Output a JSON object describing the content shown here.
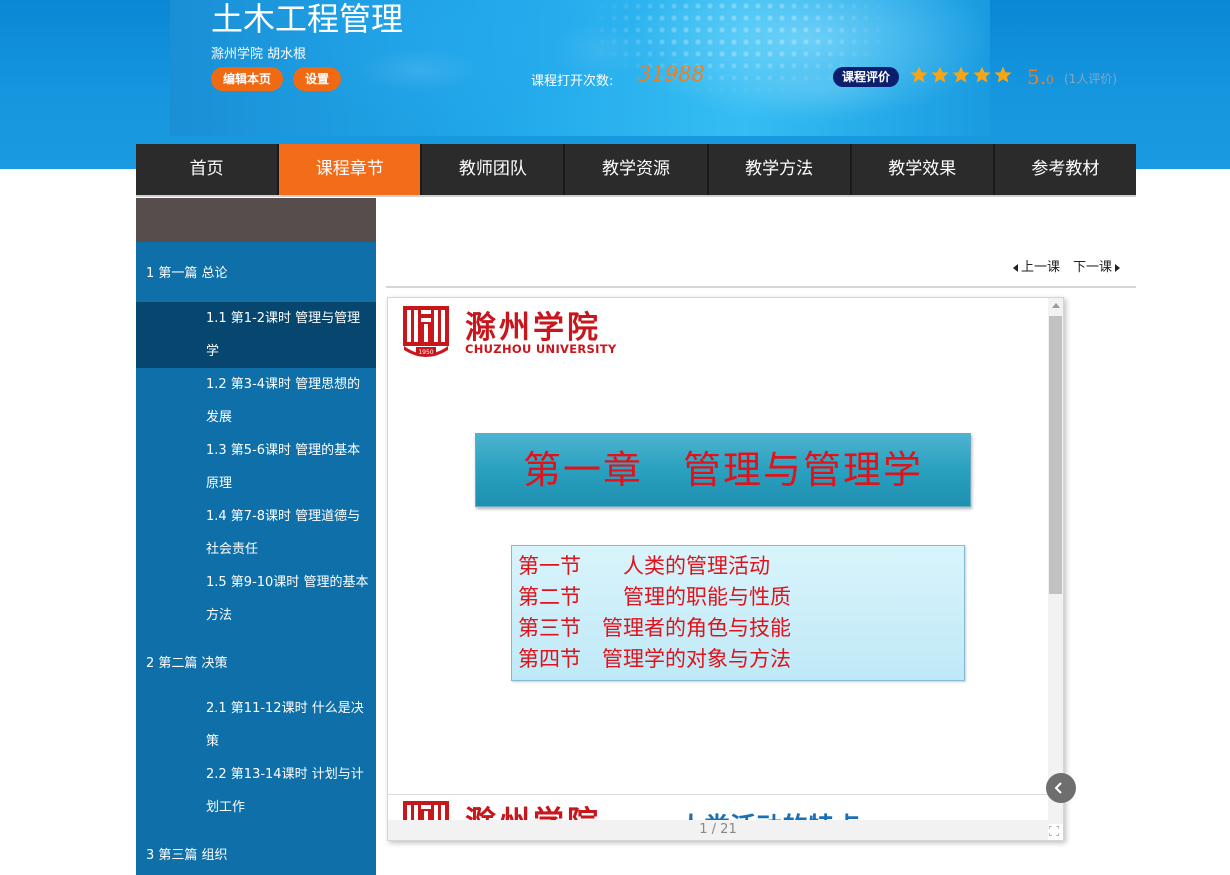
{
  "header": {
    "course_title": "土木工程管理",
    "school_teacher": "滁州学院 胡水根",
    "edit_button": "编辑本页",
    "settings_button": "设置",
    "open_count_label": "课程打开次数:",
    "open_count_value": "31988",
    "evaluation_badge": "课程评价",
    "rating_stars": 5,
    "rating_score_main": "5.",
    "rating_score_sub": "0",
    "rating_count": "(1人评价)",
    "star_color": "#f7a515"
  },
  "nav": {
    "tabs": [
      {
        "label": "首页",
        "active": false
      },
      {
        "label": "课程章节",
        "active": true
      },
      {
        "label": "教师团队",
        "active": false
      },
      {
        "label": "教学资源",
        "active": false
      },
      {
        "label": "教学方法",
        "active": false
      },
      {
        "label": "教学效果",
        "active": false
      },
      {
        "label": "参考教材",
        "active": false
      }
    ],
    "active_color": "#f26c1a"
  },
  "sidebar": {
    "sections": [
      {
        "label": "1 第一篇 总论",
        "lessons": [
          {
            "line1": "1.1 第1-2课时 管理与管理",
            "line2": "学",
            "active": true
          },
          {
            "line1": "1.2 第3-4课时 管理思想的",
            "line2": "发展",
            "active": false
          },
          {
            "line1": "1.3 第5-6课时 管理的基本",
            "line2": "原理",
            "active": false
          },
          {
            "line1": "1.4 第7-8课时 管理道德与",
            "line2": "社会责任",
            "active": false
          },
          {
            "line1": "1.5 第9-10课时 管理的基本",
            "line2": "方法",
            "active": false
          }
        ]
      },
      {
        "label": "2 第二篇 决策",
        "lessons": [
          {
            "line1": "2.1 第11-12课时 什么是决",
            "line2": "策",
            "active": false
          },
          {
            "line1": "2.2 第13-14课时 计划与计",
            "line2": "划工作",
            "active": false
          }
        ]
      },
      {
        "label": "3 第三篇 组织",
        "lessons": []
      }
    ]
  },
  "lesson_nav": {
    "prev": "上一课",
    "next": "下一课"
  },
  "viewer": {
    "logo_cn": "滁州学院",
    "logo_en": "CHUZHOU UNIVERSITY",
    "logo_year": "1950",
    "chapter_title": "第一章　管理与管理学",
    "sections": [
      "第一节　　人类的管理活动",
      "第二节　　管理的职能与性质",
      "第三节　管理者的角色与技能",
      "第四节　管理学的对象与方法"
    ],
    "next_slide_title": "人类活动的特点",
    "page_indicator": "1 / 21"
  }
}
